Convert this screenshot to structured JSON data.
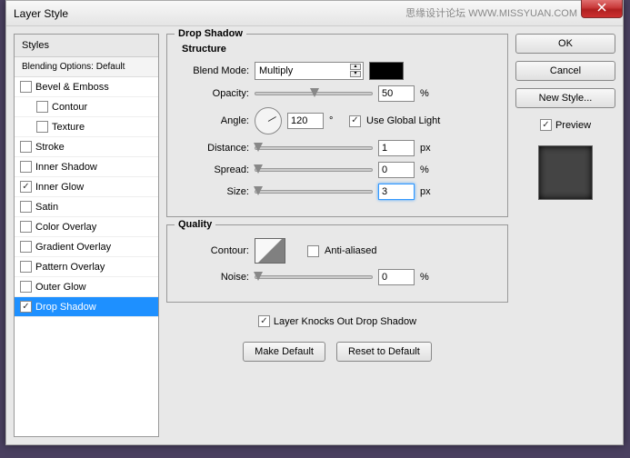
{
  "window": {
    "title": "Layer Style"
  },
  "watermark": {
    "cn": "思缘设计论坛",
    "url": "WWW.MISSYUAN.COM"
  },
  "sidebar": {
    "header": "Styles",
    "blending": "Blending Options: Default",
    "items": [
      {
        "label": "Bevel & Emboss",
        "checked": false,
        "indent": false
      },
      {
        "label": "Contour",
        "checked": false,
        "indent": true
      },
      {
        "label": "Texture",
        "checked": false,
        "indent": true
      },
      {
        "label": "Stroke",
        "checked": false,
        "indent": false
      },
      {
        "label": "Inner Shadow",
        "checked": false,
        "indent": false
      },
      {
        "label": "Inner Glow",
        "checked": true,
        "indent": false
      },
      {
        "label": "Satin",
        "checked": false,
        "indent": false
      },
      {
        "label": "Color Overlay",
        "checked": false,
        "indent": false
      },
      {
        "label": "Gradient Overlay",
        "checked": false,
        "indent": false
      },
      {
        "label": "Pattern Overlay",
        "checked": false,
        "indent": false
      },
      {
        "label": "Outer Glow",
        "checked": false,
        "indent": false
      },
      {
        "label": "Drop Shadow",
        "checked": true,
        "indent": false,
        "selected": true
      }
    ]
  },
  "panel": {
    "title": "Drop Shadow",
    "structure": {
      "title": "Structure",
      "blendMode": {
        "label": "Blend Mode:",
        "value": "Multiply"
      },
      "opacity": {
        "label": "Opacity:",
        "value": "50",
        "unit": "%"
      },
      "angle": {
        "label": "Angle:",
        "value": "120",
        "unit": "°",
        "globalLight": "Use Global Light",
        "globalChecked": true
      },
      "distance": {
        "label": "Distance:",
        "value": "1",
        "unit": "px"
      },
      "spread": {
        "label": "Spread:",
        "value": "0",
        "unit": "%"
      },
      "size": {
        "label": "Size:",
        "value": "3",
        "unit": "px"
      }
    },
    "quality": {
      "title": "Quality",
      "contour": {
        "label": "Contour:",
        "antiAliased": "Anti-aliased",
        "aaChecked": false
      },
      "noise": {
        "label": "Noise:",
        "value": "0",
        "unit": "%"
      }
    },
    "knockout": {
      "label": "Layer Knocks Out Drop Shadow",
      "checked": true
    },
    "actions": {
      "makeDefault": "Make Default",
      "reset": "Reset to Default"
    }
  },
  "right": {
    "ok": "OK",
    "cancel": "Cancel",
    "newStyle": "New Style...",
    "preview": "Preview",
    "previewChecked": true
  }
}
